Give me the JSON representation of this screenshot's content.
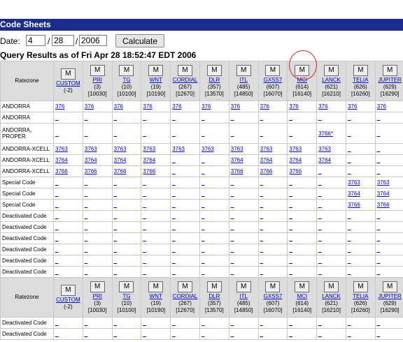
{
  "title": "Code Sheets",
  "date": {
    "label": "Date:",
    "month": "4",
    "day": "28",
    "year": "2006",
    "sep": "/",
    "calculate_label": "Calculate"
  },
  "query_results": "Query Results as of Fri Apr 28 18:52:47 EDT 2006",
  "ratezone_label": "Ratezone",
  "m_label": "M",
  "columns": [
    {
      "name": "CUSTOM",
      "c1": "(-2)",
      "c2": ""
    },
    {
      "name": "PRI",
      "c1": "(3)",
      "c2": "[10030]"
    },
    {
      "name": "TG",
      "c1": "(10)",
      "c2": "[10100]"
    },
    {
      "name": "WNT",
      "c1": "(19)",
      "c2": "[10190]"
    },
    {
      "name": "CORDIAL",
      "c1": "(267)",
      "c2": "[12670]"
    },
    {
      "name": "DLR",
      "c1": "(357)",
      "c2": "[13570]"
    },
    {
      "name": "ITL",
      "c1": "(485)",
      "c2": "[14850]"
    },
    {
      "name": "GXSS7",
      "c1": "(607)",
      "c2": "[16070]"
    },
    {
      "name": "MCI",
      "c1": "(614)",
      "c2": "[16140]"
    },
    {
      "name": "LANCK",
      "c1": "(621)",
      "c2": "[16210]"
    },
    {
      "name": "TELIA",
      "c1": "(626)",
      "c2": "[16260]"
    },
    {
      "name": "JUPITER",
      "c1": "(629)",
      "c2": "[16290]"
    }
  ],
  "rows": [
    {
      "rz": "ANDORRA",
      "cells": [
        "376",
        "376",
        "376",
        "376",
        "376",
        "376",
        "376",
        "376",
        "376",
        "376",
        "376",
        "376"
      ]
    },
    {
      "rz": "ANDORRA",
      "cells": [
        "_",
        "_",
        "_",
        "_",
        "_",
        "_",
        "_",
        "_",
        "_",
        "_",
        "_",
        "_"
      ]
    },
    {
      "rz": "ANDORRA, PROPER",
      "tall": true,
      "cells": [
        "_",
        "_",
        "_",
        "_",
        "_",
        "_",
        "_",
        "_",
        "_",
        "3766*",
        "_",
        "_"
      ]
    },
    {
      "rz": "ANDORRA-XCELL",
      "cells": [
        "3763",
        "3763",
        "3763",
        "3763",
        "3763",
        "3763",
        "3763",
        "3763",
        "3763",
        "3763",
        "_",
        "_"
      ]
    },
    {
      "rz": "ANDORRA-XCELL",
      "cells": [
        "3764",
        "3764",
        "3764",
        "3764",
        "_",
        "_",
        "3764",
        "3764",
        "3764",
        "3764",
        "_",
        "_"
      ]
    },
    {
      "rz": "ANDORRA-XCELL",
      "cells": [
        "3766",
        "3766",
        "3766",
        "3766",
        "_",
        "_",
        "3766",
        "3766",
        "3766",
        "_",
        "_",
        "_"
      ]
    },
    {
      "rz": "Special Code",
      "cells": [
        "_",
        "_",
        "_",
        "_",
        "_",
        "_",
        "_",
        "_",
        "_",
        "_",
        "3763",
        "3763"
      ]
    },
    {
      "rz": "Special Code",
      "cells": [
        "_",
        "_",
        "_",
        "_",
        "_",
        "_",
        "_",
        "_",
        "_",
        "_",
        "3764",
        "3764"
      ]
    },
    {
      "rz": "Special Code",
      "cells": [
        "_",
        "_",
        "_",
        "_",
        "_",
        "_",
        "_",
        "_",
        "_",
        "_",
        "3766",
        "3766"
      ]
    },
    {
      "rz": "Deactivated Code",
      "cells": [
        "_",
        "_",
        "_",
        "_",
        "_",
        "_",
        "_",
        "_",
        "_",
        "_",
        "_",
        "_"
      ]
    },
    {
      "rz": "Deactivated Code",
      "cells": [
        "_",
        "_",
        "_",
        "_",
        "_",
        "_",
        "_",
        "_",
        "_",
        "_",
        "_",
        "_"
      ]
    },
    {
      "rz": "Deactivated Code",
      "cells": [
        "_",
        "_",
        "_",
        "_",
        "_",
        "_",
        "_",
        "_",
        "_",
        "_",
        "_",
        "_"
      ]
    },
    {
      "rz": "Deactivated Code",
      "cells": [
        "_",
        "_",
        "_",
        "_",
        "_",
        "_",
        "_",
        "_",
        "_",
        "_",
        "_",
        "_"
      ]
    },
    {
      "rz": "Deactivated Code",
      "cells": [
        "_",
        "_",
        "_",
        "_",
        "_",
        "_",
        "_",
        "_",
        "_",
        "_",
        "_",
        "_"
      ]
    },
    {
      "rz": "Deactivated Code",
      "cells": [
        "_",
        "_",
        "_",
        "_",
        "_",
        "_",
        "_",
        "_",
        "_",
        "_",
        "_",
        "_"
      ]
    }
  ],
  "rows_bottom": [
    {
      "rz": "Deactivated Code",
      "cells": [
        "_",
        "_",
        "_",
        "_",
        "_",
        "_",
        "_",
        "_",
        "_",
        "_",
        "_",
        "_"
      ]
    },
    {
      "rz": "Deactivated Code",
      "cells": [
        "_",
        "_",
        "_",
        "_",
        "_",
        "_",
        "_",
        "_",
        "_",
        "_",
        "_",
        "_"
      ]
    }
  ],
  "colors": {
    "titlebar": "#1c2c8c",
    "link": "#0000cc",
    "header_bg": "#dcdcdc",
    "annotation_circle": "#e02020"
  }
}
